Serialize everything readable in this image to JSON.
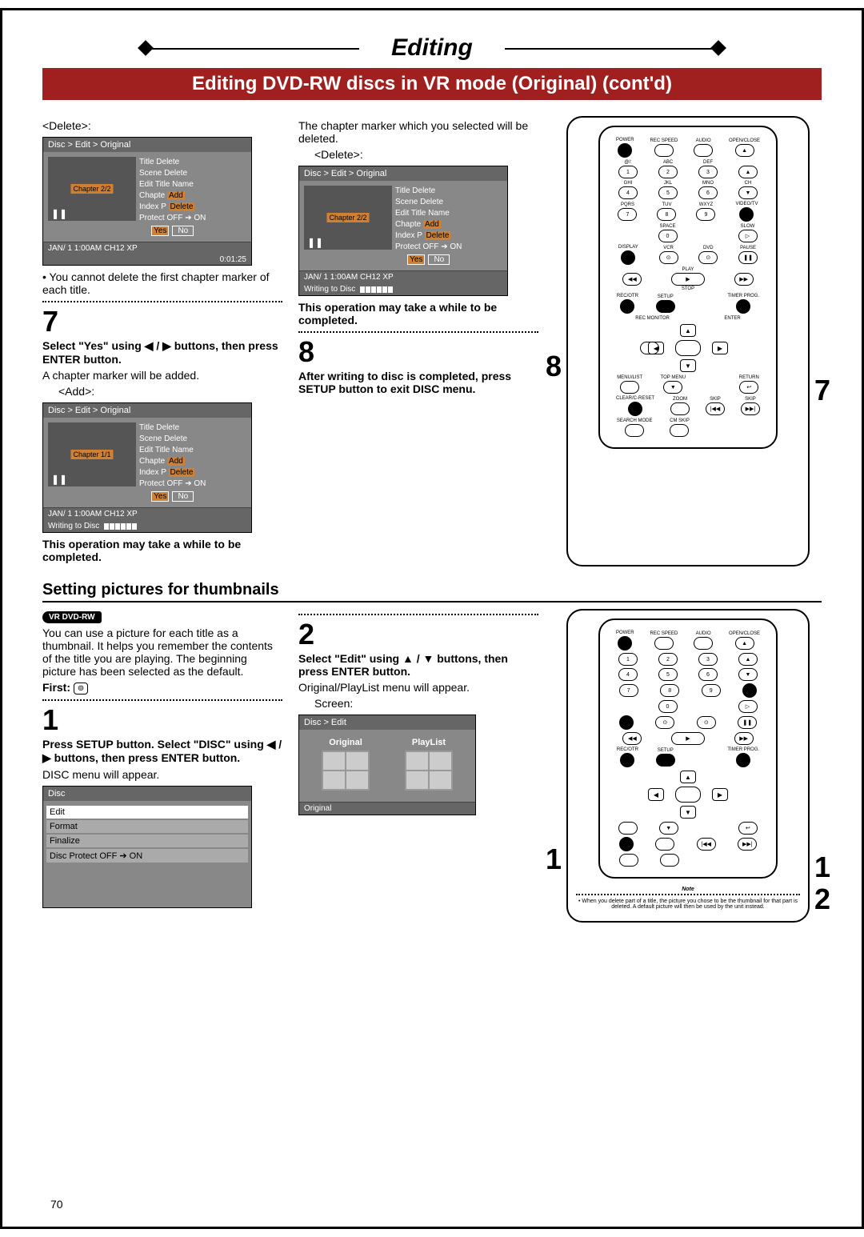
{
  "header": {
    "title": "Editing",
    "subtitle": "Editing DVD-RW discs in VR mode (Original) (cont'd)"
  },
  "col1": {
    "delete_label": "<Delete>:",
    "osd1": {
      "crumb": "Disc > Edit > Original",
      "chapter": "Chapter 2/2",
      "menu": [
        "Title Delete",
        "Scene Delete",
        "Edit Title Name",
        "Chapter Mark",
        "Index Picture",
        "Protect OFF ➔ ON"
      ],
      "chapter_opts_add": "Add",
      "chapter_opts_del": "Delete",
      "yes": "Yes",
      "no": "No",
      "status": "JAN/ 1   1:00AM  CH12      XP",
      "timer": "0:01:25"
    },
    "note1": "• You cannot delete the first chapter marker of each title.",
    "step7": "7",
    "step7_bold": "Select \"Yes\" using ◀ / ▶ buttons, then press ENTER button.",
    "step7_body": "A chapter marker will be added.",
    "add_label": "<Add>:",
    "osd2": {
      "crumb": "Disc > Edit > Original",
      "chapter": "Chapter 1/1",
      "status": "JAN/ 1   1:00AM  CH12      XP",
      "writing": "Writing to Disc"
    },
    "warn": "This operation may take a while to be completed."
  },
  "col2": {
    "intro": "The chapter marker which you selected will be deleted.",
    "delete_label": "<Delete>:",
    "osd3": {
      "crumb": "Disc > Edit > Original",
      "chapter": "Chapter 2/2",
      "status": "JAN/ 1   1:00AM  CH12      XP",
      "writing": "Writing to Disc"
    },
    "warn": "This operation may take a while to be completed.",
    "step8": "8",
    "step8_bold": "After writing to disc is completed, press SETUP button to exit DISC menu."
  },
  "section2": {
    "title": "Setting pictures for thumbnails",
    "badge": "VR DVD-RW",
    "col1": {
      "intro": "You can use a picture for each title as a thumbnail. It helps you remember the contents of the title you are playing. The beginning picture has been selected as the default.",
      "first": "First:",
      "step1": "1",
      "step1_bold": "Press SETUP button. Select \"DISC\" using ◀ / ▶ buttons, then press ENTER button.",
      "step1_body": "DISC menu will appear.",
      "osd4": {
        "crumb": "Disc",
        "items": [
          "Edit",
          "Format",
          "Finalize",
          "Disc Protect OFF ➔ ON"
        ]
      }
    },
    "col2": {
      "step2": "2",
      "step2_bold": "Select \"Edit\" using ▲ / ▼ buttons, then press ENTER button.",
      "step2_body": "Original/PlayList menu will appear.",
      "screen": "Screen:",
      "osd5": {
        "crumb": "Disc > Edit",
        "opt1": "Original",
        "opt2": "PlayList",
        "sel": "Original"
      }
    },
    "col3": {
      "note_title": "Note",
      "note_body": "• When you delete part of a title, the picture you chose to be the thumbnail for that part is deleted. A default picture will then be used by the unit instead."
    }
  },
  "remote_callouts": {
    "r1_left": "8",
    "r1_right": "7",
    "r2_left": "1",
    "r2_right1": "1",
    "r2_right2": "2"
  },
  "remote_labels": {
    "power": "POWER",
    "recspeed": "REC SPEED",
    "audio": "AUDIO",
    "openclose": "OPEN/CLOSE",
    "abc": "ABC",
    "def": "DEF",
    "ghi": "GHI",
    "jkl": "JKL",
    "mno": "MNO",
    "ch": "CH",
    "pqrs": "PQRS",
    "tuv": "TUV",
    "wxyz": "WXYZ",
    "videotv": "VIDEO/TV",
    "space": "SPACE",
    "slow": "SLOW",
    "display": "DISPLAY",
    "vcr": "VCR",
    "dvd": "DVD",
    "pause": "PAUSE",
    "play": "PLAY",
    "stop": "STOP",
    "rew": "◀◀",
    "ff": "▶▶",
    "recotr": "REC/OTR",
    "setup": "SETUP",
    "timerprog": "TIMER PROG.",
    "recmonitor": "REC MONITOR",
    "enter": "ENTER",
    "menulist": "MENU/LIST",
    "topmenu": "TOP MENU",
    "return": "RETURN",
    "clear": "CLEAR/C-RESET",
    "zoom": "ZOOM",
    "skip": "SKIP",
    "searchmode": "SEARCH MODE",
    "cmskip": "CM SKIP"
  },
  "page_number": "70"
}
